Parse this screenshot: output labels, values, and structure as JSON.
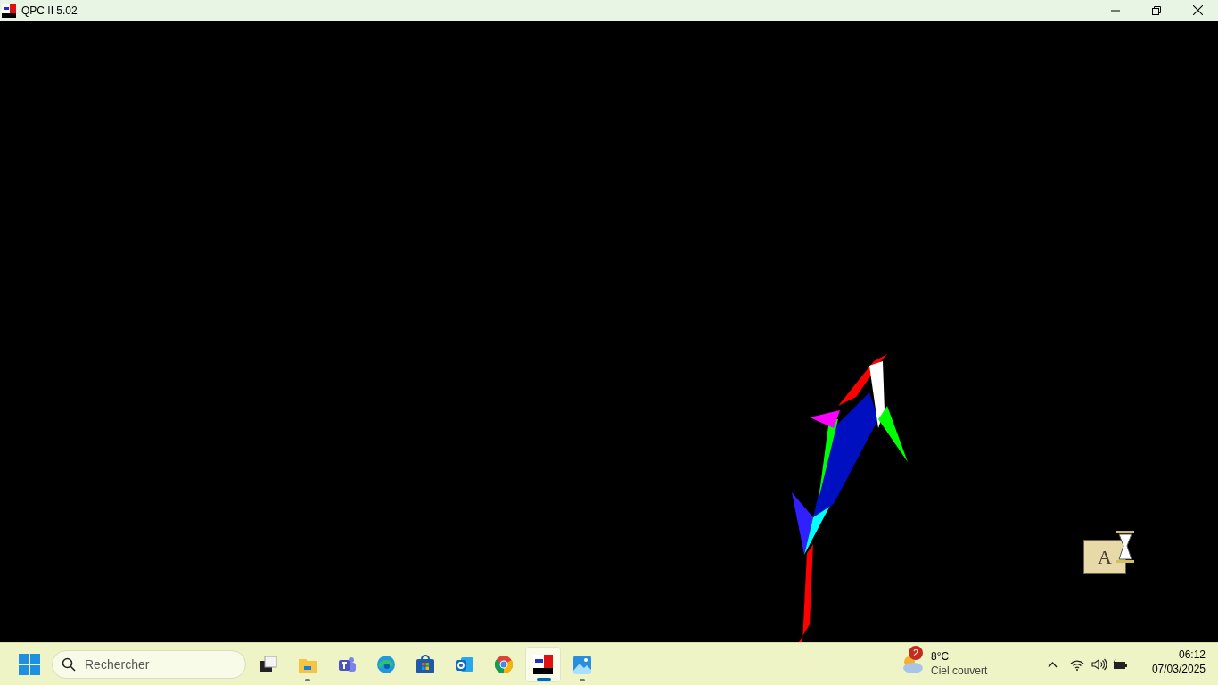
{
  "window": {
    "title": "QPC II 5.02"
  },
  "canvas": {
    "cursor_label": "A"
  },
  "taskbar": {
    "search": {
      "placeholder": "Rechercher"
    },
    "apps": [
      {
        "kind": "taskview",
        "running": false,
        "selected": false
      },
      {
        "kind": "explorer",
        "running": true,
        "selected": false
      },
      {
        "kind": "teams",
        "running": false,
        "selected": false
      },
      {
        "kind": "edge",
        "running": false,
        "selected": false
      },
      {
        "kind": "store",
        "running": false,
        "selected": false
      },
      {
        "kind": "outlook",
        "running": false,
        "selected": false
      },
      {
        "kind": "chrome",
        "running": false,
        "selected": false
      },
      {
        "kind": "qpc",
        "running": true,
        "selected": true
      },
      {
        "kind": "photos",
        "running": true,
        "selected": false
      }
    ],
    "weather": {
      "badge": "2",
      "temperature": "8°C",
      "condition": "Ciel couvert"
    },
    "clock": {
      "time": "06:12",
      "date": "07/03/2025"
    }
  }
}
